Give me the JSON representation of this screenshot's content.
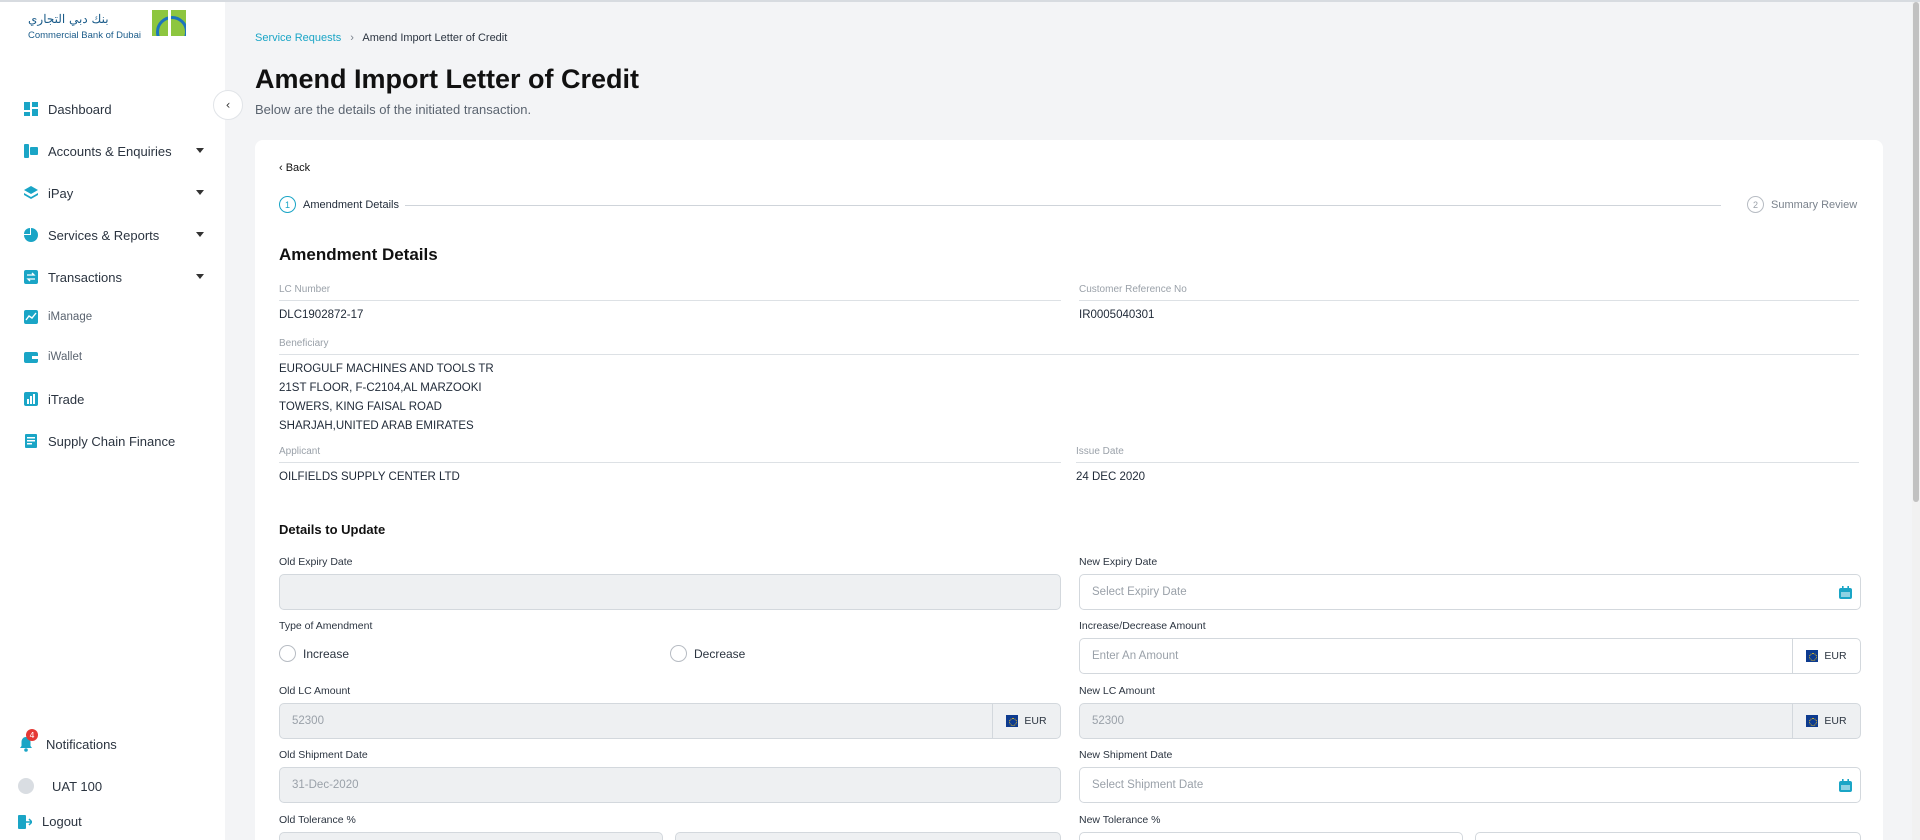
{
  "brand": {
    "arabic_name": "بنك دبي التجاري",
    "english_name": "Commercial Bank of Dubai"
  },
  "sidebar": {
    "items": [
      {
        "label": "Dashboard",
        "icon": "dashboard-icon",
        "has_caret": false
      },
      {
        "label": "Accounts & Enquiries",
        "icon": "accounts-icon",
        "has_caret": true
      },
      {
        "label": "iPay",
        "icon": "ipay-icon",
        "has_caret": true
      },
      {
        "label": "Services & Reports",
        "icon": "pie-chart-icon",
        "has_caret": true
      },
      {
        "label": "Transactions",
        "icon": "transactions-icon",
        "has_caret": true
      },
      {
        "label": "iManage",
        "icon": "imanage-icon",
        "has_caret": false
      },
      {
        "label": "iWallet",
        "icon": "wallet-icon",
        "has_caret": false
      },
      {
        "label": "iTrade",
        "icon": "itrade-icon",
        "has_caret": false
      },
      {
        "label": "Supply Chain Finance",
        "icon": "supply-chain-icon",
        "has_caret": false
      }
    ],
    "notifications": {
      "label": "Notifications",
      "count": "4"
    },
    "user": {
      "label": "UAT 100"
    },
    "logout": {
      "label": "Logout"
    }
  },
  "breadcrumb": {
    "parent": "Service Requests",
    "separator": "›",
    "current": "Amend Import Letter of Credit"
  },
  "page": {
    "title": "Amend Import Letter of Credit",
    "subtitle": "Below are the details of the initiated transaction."
  },
  "card": {
    "back_label": "‹ Back",
    "steps": [
      {
        "number": "1",
        "label": "Amendment Details",
        "active": true
      },
      {
        "number": "2",
        "label": "Summary Review",
        "active": false
      }
    ],
    "section_title": "Amendment Details",
    "details": {
      "lc_number": {
        "label": "LC Number",
        "value": "DLC1902872-17"
      },
      "customer_reference": {
        "label": "Customer Reference No",
        "value": "IR0005040301"
      },
      "beneficiary": {
        "label": "Beneficiary",
        "lines": [
          "EUROGULF MACHINES AND TOOLS TR",
          "21ST FLOOR, F-C2104,AL MARZOOKI",
          "TOWERS, KING FAISAL ROAD",
          "SHARJAH,UNITED ARAB EMIRATES"
        ]
      },
      "applicant": {
        "label": "Applicant",
        "value": "OILFIELDS SUPPLY CENTER LTD"
      },
      "issue_date": {
        "label": "Issue Date",
        "value": "24 DEC 2020"
      }
    },
    "update_title": "Details to Update",
    "form": {
      "old_expiry": {
        "label": "Old Expiry Date",
        "value": ""
      },
      "new_expiry": {
        "label": "New Expiry Date",
        "placeholder": "Select Expiry Date"
      },
      "type_of_amendment": {
        "label": "Type of Amendment",
        "options": [
          "Increase",
          "Decrease"
        ]
      },
      "increase_decrease_amount": {
        "label": "Increase/Decrease Amount",
        "placeholder": "Enter An Amount",
        "currency": "EUR"
      },
      "old_lc_amount": {
        "label": "Old LC Amount",
        "value": "52300",
        "currency": "EUR"
      },
      "new_lc_amount": {
        "label": "New LC Amount",
        "value": "52300",
        "currency": "EUR"
      },
      "old_shipment": {
        "label": "Old Shipment Date",
        "value": "31-Dec-2020"
      },
      "new_shipment": {
        "label": "New Shipment Date",
        "placeholder": "Select Shipment Date"
      },
      "old_tolerance": {
        "label": "Old Tolerance %"
      },
      "new_tolerance": {
        "label": "New Tolerance %"
      }
    }
  },
  "colors": {
    "accent": "#1aa5c6",
    "background": "#f3f4f6",
    "text": "#1f2937"
  }
}
